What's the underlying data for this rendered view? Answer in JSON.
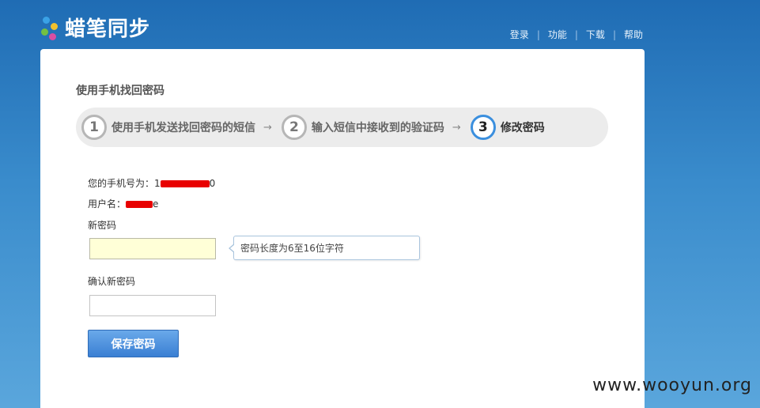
{
  "brand": {
    "name": "蜡笔同步",
    "dot_colors": [
      "#3aa2e6",
      "#f2c12e",
      "#73c043",
      "#d84fa3"
    ]
  },
  "topnav": {
    "items": [
      "登录",
      "功能",
      "下载",
      "帮助"
    ]
  },
  "page": {
    "title": "使用手机找回密码"
  },
  "steps": [
    {
      "num": "1",
      "label": "使用手机发送找回密码的短信",
      "active": false
    },
    {
      "num": "2",
      "label": "输入短信中接收到的验证码",
      "active": false
    },
    {
      "num": "3",
      "label": "修改密码",
      "active": true
    }
  ],
  "step_arrow": "→",
  "form": {
    "phone_label": "您的手机号为：",
    "phone_visible_prefix": "1",
    "phone_visible_suffix": "0",
    "username_label": "用户名：",
    "username_visible_suffix": "e",
    "new_password_label": "新密码",
    "new_password_tip": "密码长度为6至16位字符",
    "confirm_password_label": "确认新密码",
    "save_label": "保存密码"
  },
  "watermark": "www.wooyun.org"
}
